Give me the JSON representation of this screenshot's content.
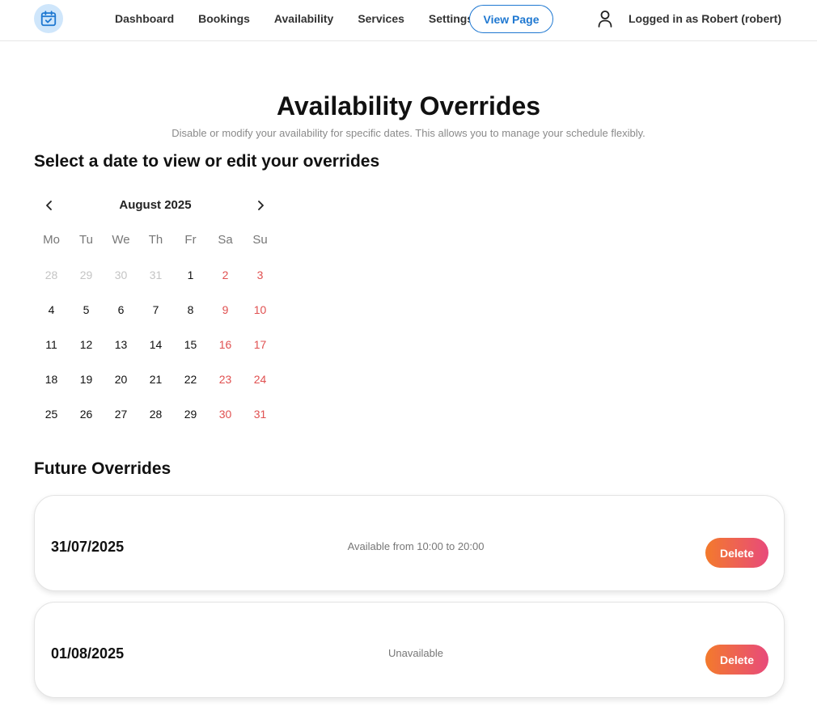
{
  "header": {
    "nav": [
      "Dashboard",
      "Bookings",
      "Availability",
      "Services",
      "Settings"
    ],
    "view_page": "View Page",
    "user_label": "Logged in as Robert (robert)"
  },
  "page": {
    "title": "Availability Overrides",
    "subtitle": "Disable or modify your availability for specific dates. This allows you to manage your schedule flexibly.",
    "select_heading": "Select a date to view or edit your overrides",
    "future_heading": "Future Overrides"
  },
  "calendar": {
    "month_label": "August 2025",
    "weekdays": [
      "Mo",
      "Tu",
      "We",
      "Th",
      "Fr",
      "Sa",
      "Su"
    ],
    "days": [
      {
        "d": "28",
        "muted": true,
        "weekend": false
      },
      {
        "d": "29",
        "muted": true,
        "weekend": false
      },
      {
        "d": "30",
        "muted": true,
        "weekend": false
      },
      {
        "d": "31",
        "muted": true,
        "weekend": false
      },
      {
        "d": "1",
        "muted": false,
        "weekend": false
      },
      {
        "d": "2",
        "muted": false,
        "weekend": true
      },
      {
        "d": "3",
        "muted": false,
        "weekend": true
      },
      {
        "d": "4",
        "muted": false,
        "weekend": false
      },
      {
        "d": "5",
        "muted": false,
        "weekend": false
      },
      {
        "d": "6",
        "muted": false,
        "weekend": false
      },
      {
        "d": "7",
        "muted": false,
        "weekend": false
      },
      {
        "d": "8",
        "muted": false,
        "weekend": false
      },
      {
        "d": "9",
        "muted": false,
        "weekend": true
      },
      {
        "d": "10",
        "muted": false,
        "weekend": true
      },
      {
        "d": "11",
        "muted": false,
        "weekend": false
      },
      {
        "d": "12",
        "muted": false,
        "weekend": false
      },
      {
        "d": "13",
        "muted": false,
        "weekend": false
      },
      {
        "d": "14",
        "muted": false,
        "weekend": false
      },
      {
        "d": "15",
        "muted": false,
        "weekend": false
      },
      {
        "d": "16",
        "muted": false,
        "weekend": true
      },
      {
        "d": "17",
        "muted": false,
        "weekend": true
      },
      {
        "d": "18",
        "muted": false,
        "weekend": false
      },
      {
        "d": "19",
        "muted": false,
        "weekend": false
      },
      {
        "d": "20",
        "muted": false,
        "weekend": false
      },
      {
        "d": "21",
        "muted": false,
        "weekend": false
      },
      {
        "d": "22",
        "muted": false,
        "weekend": false
      },
      {
        "d": "23",
        "muted": false,
        "weekend": true
      },
      {
        "d": "24",
        "muted": false,
        "weekend": true
      },
      {
        "d": "25",
        "muted": false,
        "weekend": false
      },
      {
        "d": "26",
        "muted": false,
        "weekend": false
      },
      {
        "d": "27",
        "muted": false,
        "weekend": false
      },
      {
        "d": "28",
        "muted": false,
        "weekend": false
      },
      {
        "d": "29",
        "muted": false,
        "weekend": false
      },
      {
        "d": "30",
        "muted": false,
        "weekend": true
      },
      {
        "d": "31",
        "muted": false,
        "weekend": true
      }
    ]
  },
  "overrides": [
    {
      "date": "31/07/2025",
      "status": "Available from 10:00 to 20:00",
      "action": "Delete"
    },
    {
      "date": "01/08/2025",
      "status": "Unavailable",
      "action": "Delete"
    }
  ],
  "icons": {
    "logo": "calendar-check-icon",
    "user": "user-icon",
    "prev": "chevron-left-icon",
    "next": "chevron-right-icon"
  },
  "colors": {
    "accent": "#1f78d1",
    "weekend": "#e05050",
    "delete_gradient_start": "#f37a2c",
    "delete_gradient_end": "#e84a7b"
  }
}
